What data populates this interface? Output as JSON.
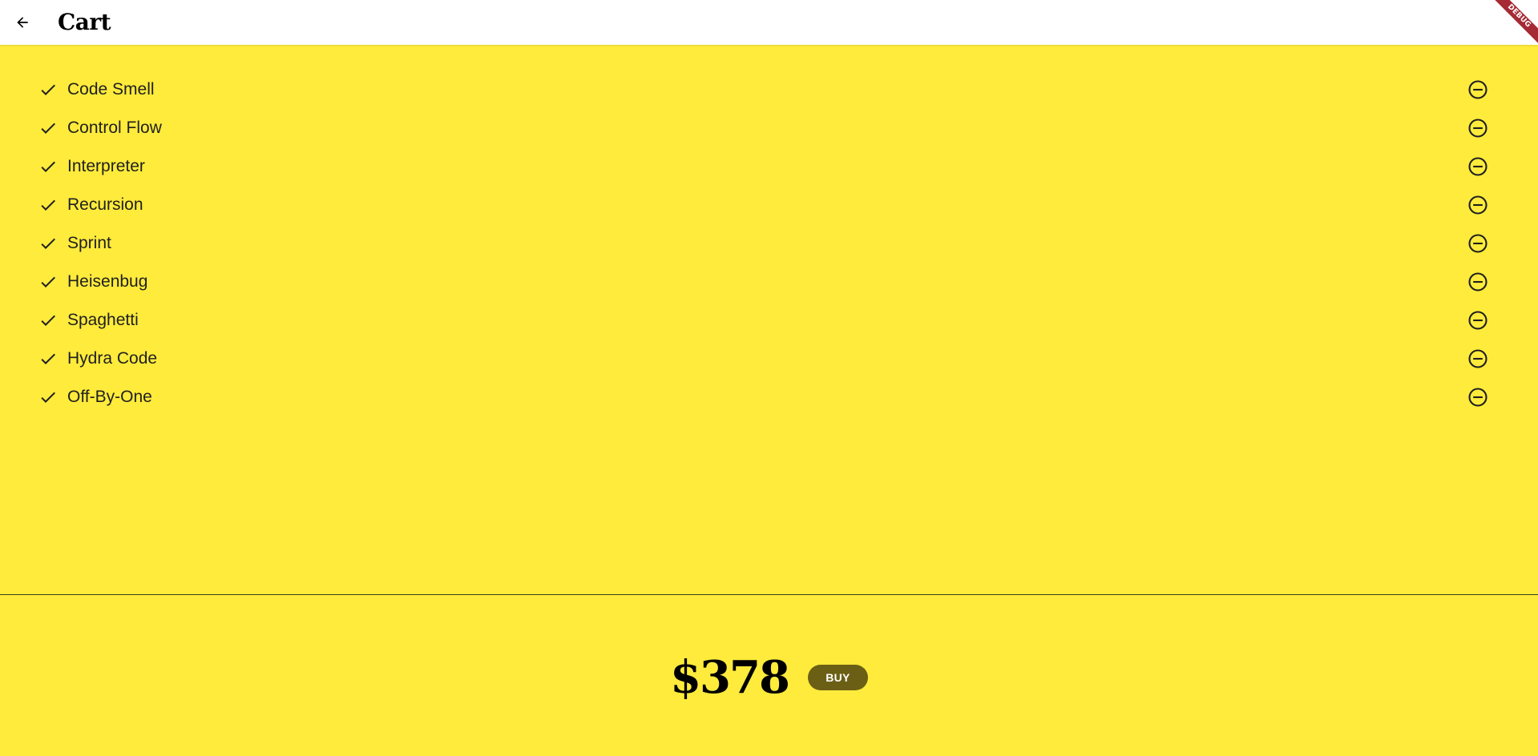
{
  "appbar": {
    "title": "Cart",
    "back_icon": "arrow-back-icon"
  },
  "debug_banner": "DEBUG",
  "cart": {
    "items": [
      {
        "name": "Code Smell"
      },
      {
        "name": "Control Flow"
      },
      {
        "name": "Interpreter"
      },
      {
        "name": "Recursion"
      },
      {
        "name": "Sprint"
      },
      {
        "name": "Heisenbug"
      },
      {
        "name": "Spaghetti"
      },
      {
        "name": "Hydra Code"
      },
      {
        "name": "Off-By-One"
      }
    ],
    "item_icon": "check-icon",
    "remove_icon": "remove-circle-outline-icon"
  },
  "total": {
    "price": "$378",
    "buy_label": "BUY"
  },
  "colors": {
    "background": "#ffeb3b",
    "appbar": "#ffffff",
    "buy_button": "#6b5f15",
    "debug_ribbon": "#a52a35"
  }
}
